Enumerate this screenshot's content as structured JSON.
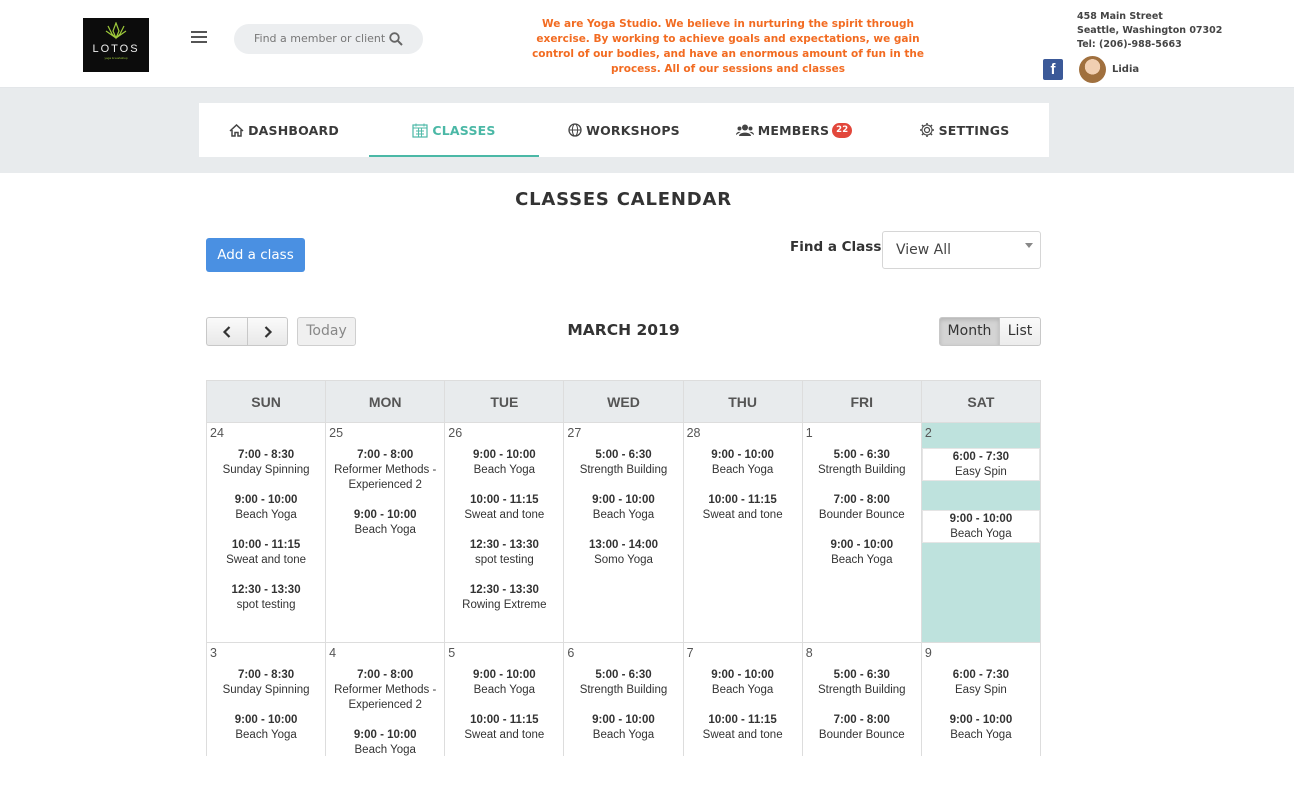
{
  "header": {
    "logo_name": "LOTOS",
    "logo_tagline": "yoga & workshop",
    "search_placeholder": "Find a member or client",
    "mission": "We are Yoga Studio. We believe in nurturing the spirit through exercise. By working to achieve goals and expectations, we gain control of our bodies, and have an enormous amount of fun in the process. All of our sessions and classes",
    "address_line1": "458 Main Street",
    "address_line2": "Seattle, Washington 07302",
    "address_line3": "Tel:  (206)-988-5663",
    "user_name": "Lidia"
  },
  "nav": {
    "tabs": [
      {
        "label": "DASHBOARD",
        "icon": "home-icon"
      },
      {
        "label": "CLASSES",
        "icon": "calendar-icon"
      },
      {
        "label": "WORKSHOPS",
        "icon": "globe-icon"
      },
      {
        "label": "MEMBERS",
        "icon": "people-icon",
        "badge": "22"
      },
      {
        "label": "SETTINGS",
        "icon": "gear-icon"
      }
    ],
    "active": "CLASSES"
  },
  "main": {
    "title": "CLASSES CALENDAR",
    "add_button": "Add a class",
    "find_label": "Find a Class :",
    "find_value": "View All"
  },
  "calendar": {
    "today_button": "Today",
    "month_title": "MARCH 2019",
    "view_month": "Month",
    "view_list": "List",
    "weekdays": [
      "SUN",
      "MON",
      "TUE",
      "WED",
      "THU",
      "FRI",
      "SAT"
    ],
    "weeks": [
      [
        {
          "date": "24",
          "events": [
            {
              "time": "7:00 - 8:30",
              "title": "Sunday Spinning"
            },
            {
              "time": "9:00 - 10:00",
              "title": "Beach Yoga"
            },
            {
              "time": "10:00 - 11:15",
              "title": "Sweat and tone"
            },
            {
              "time": "12:30 - 13:30",
              "title": "spot testing"
            }
          ]
        },
        {
          "date": "25",
          "events": [
            {
              "time": "7:00 - 8:00",
              "title": "Reformer Methods - Experienced 2"
            },
            {
              "time": "9:00 - 10:00",
              "title": "Beach Yoga"
            }
          ]
        },
        {
          "date": "26",
          "events": [
            {
              "time": "9:00 - 10:00",
              "title": "Beach Yoga"
            },
            {
              "time": "10:00 - 11:15",
              "title": "Sweat and tone"
            },
            {
              "time": "12:30 - 13:30",
              "title": "spot testing"
            },
            {
              "time": "12:30 - 13:30",
              "title": "Rowing Extreme"
            }
          ]
        },
        {
          "date": "27",
          "events": [
            {
              "time": "5:00 - 6:30",
              "title": "Strength Building"
            },
            {
              "time": "9:00 - 10:00",
              "title": "Beach Yoga"
            },
            {
              "time": "13:00 - 14:00",
              "title": "Somo Yoga"
            }
          ]
        },
        {
          "date": "28",
          "events": [
            {
              "time": "9:00 - 10:00",
              "title": "Beach Yoga"
            },
            {
              "time": "10:00 - 11:15",
              "title": "Sweat and tone"
            }
          ]
        },
        {
          "date": "1",
          "events": [
            {
              "time": "5:00 - 6:30",
              "title": "Strength Building"
            },
            {
              "time": "7:00 - 8:00",
              "title": "Bounder Bounce"
            },
            {
              "time": "9:00 - 10:00",
              "title": "Beach Yoga"
            }
          ]
        },
        {
          "date": "2",
          "today": true,
          "events": [
            {
              "time": "6:00 - 7:30",
              "title": "Easy Spin"
            },
            {
              "time": "9:00 - 10:00",
              "title": "Beach Yoga"
            }
          ]
        }
      ],
      [
        {
          "date": "3",
          "events": [
            {
              "time": "7:00 - 8:30",
              "title": "Sunday Spinning"
            },
            {
              "time": "9:00 - 10:00",
              "title": "Beach Yoga"
            }
          ]
        },
        {
          "date": "4",
          "events": [
            {
              "time": "7:00 - 8:00",
              "title": "Reformer Methods - Experienced 2"
            },
            {
              "time": "9:00 - 10:00",
              "title": "Beach Yoga"
            }
          ]
        },
        {
          "date": "5",
          "events": [
            {
              "time": "9:00 - 10:00",
              "title": "Beach Yoga"
            },
            {
              "time": "10:00 - 11:15",
              "title": "Sweat and tone"
            }
          ]
        },
        {
          "date": "6",
          "events": [
            {
              "time": "5:00 - 6:30",
              "title": "Strength Building"
            },
            {
              "time": "9:00 - 10:00",
              "title": "Beach Yoga"
            }
          ]
        },
        {
          "date": "7",
          "events": [
            {
              "time": "9:00 - 10:00",
              "title": "Beach Yoga"
            },
            {
              "time": "10:00 - 11:15",
              "title": "Sweat and tone"
            }
          ]
        },
        {
          "date": "8",
          "events": [
            {
              "time": "5:00 - 6:30",
              "title": "Strength Building"
            },
            {
              "time": "7:00 - 8:00",
              "title": "Bounder Bounce"
            }
          ]
        },
        {
          "date": "9",
          "events": [
            {
              "time": "6:00 - 7:30",
              "title": "Easy Spin"
            },
            {
              "time": "9:00 - 10:00",
              "title": "Beach Yoga"
            }
          ]
        }
      ]
    ]
  },
  "colors": {
    "accent": "#4bb8a6",
    "primary_button": "#4a90e2",
    "mission_text": "#f26b21",
    "today_bg": "#bee2dd",
    "badge": "#e2473b"
  }
}
